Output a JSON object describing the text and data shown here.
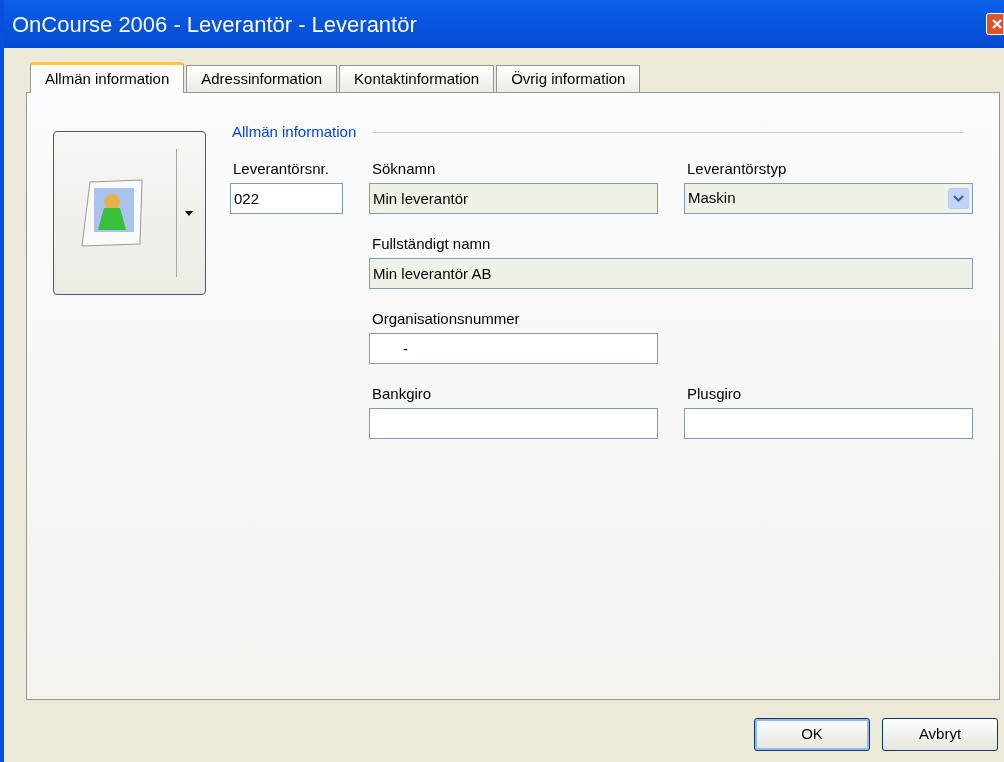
{
  "window": {
    "title": "OnCourse 2006 - Leverantör - Leverantör"
  },
  "tabs": [
    {
      "label": "Allmän information",
      "selected": true
    },
    {
      "label": "Adressinformation",
      "selected": false
    },
    {
      "label": "Kontaktinformation",
      "selected": false
    },
    {
      "label": "Övrig information",
      "selected": false
    }
  ],
  "group": {
    "title": "Allmän information"
  },
  "fields": [
    {
      "label": "Leverantörsnr.",
      "value": "022",
      "kind": "text",
      "tinted": false
    },
    {
      "label": "Söknamn",
      "value": "Min leverantör",
      "kind": "text",
      "tinted": true
    },
    {
      "label": "Leverantörstyp",
      "value": "Maskin",
      "kind": "select",
      "tinted": true
    },
    {
      "label": "Fullständigt namn",
      "value": "Min leverantör AB",
      "kind": "text",
      "tinted": true
    },
    {
      "label": "Organisationsnummer",
      "value": "-",
      "kind": "masked",
      "tinted": false
    },
    {
      "label": "Bankgiro",
      "kind": "text",
      "tinted": false
    },
    {
      "label": "Plusgiro",
      "kind": "text",
      "tinted": false
    }
  ],
  "buttons": [
    {
      "label": "OK",
      "default": true
    },
    {
      "label": "Avbryt",
      "default": false
    }
  ]
}
